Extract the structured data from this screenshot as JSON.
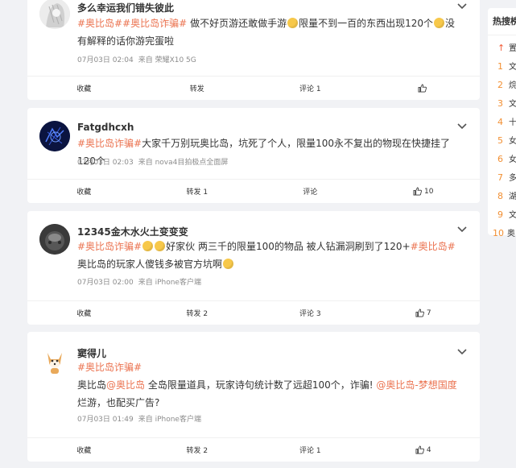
{
  "posts": [
    {
      "username": "多么幸运我们错失彼此",
      "content": [
        {
          "type": "topic",
          "text": "#奥比岛#"
        },
        {
          "type": "topic",
          "text": "#奥比岛诈骗#"
        },
        {
          "type": "text",
          "text": "做不好页游还敢做手游"
        },
        {
          "type": "emoji",
          "name": "thinking-emoji"
        },
        {
          "type": "text",
          "text": "限量不到一百的东西出现120个"
        },
        {
          "type": "emoji",
          "name": "thinking-emoji"
        },
        {
          "type": "text",
          "text": "没有解释的话你游完蛋啦"
        }
      ],
      "time": "07月03日 02:04",
      "source": "来自 荣耀X10 5G",
      "actions": {
        "collect": "收藏",
        "repost": "转发",
        "comment": "评论 1",
        "like": ""
      }
    },
    {
      "username": "Fatgdhcxh",
      "content": [
        {
          "type": "topic",
          "text": "#奥比岛诈骗#"
        },
        {
          "type": "text",
          "text": "大家千万别玩奥比岛，坑死了个人，限量100永不复出的物现在快捷挂了120个"
        }
      ],
      "time": "07月03日 02:03",
      "source": "来自 nova4目拍极点全面屏",
      "actions": {
        "collect": "收藏",
        "repost": "转发 1",
        "comment": "评论",
        "like": "10"
      }
    },
    {
      "username": "12345金木水火土变变变",
      "content": [
        {
          "type": "topic",
          "text": "#奥比岛诈骗#"
        },
        {
          "type": "emoji",
          "name": "laughing-emoji"
        },
        {
          "type": "emoji",
          "name": "laughing-emoji"
        },
        {
          "type": "text",
          "text": "好家伙 两三千的限量100的物品 被人钻漏洞刷到了120+"
        },
        {
          "type": "topic",
          "text": "#奥比岛#"
        },
        {
          "type": "text",
          "text": " 奥比岛的玩家人傻钱多被官方坑啊"
        },
        {
          "type": "emoji",
          "name": "laughing-emoji"
        }
      ],
      "time": "07月03日 02:00",
      "source": "来自 iPhone客户端",
      "actions": {
        "collect": "收藏",
        "repost": "转发 2",
        "comment": "评论 3",
        "like": "7"
      }
    },
    {
      "username": "窦得儿",
      "content_line1": [
        {
          "type": "topic",
          "text": "#奥比岛诈骗#"
        }
      ],
      "content": [
        {
          "type": "text",
          "text": "奥比岛"
        },
        {
          "type": "mention",
          "text": "@奥比岛"
        },
        {
          "type": "text",
          "text": " 全岛限量道具，玩家诗句统计数了远超100个，诈骗! "
        },
        {
          "type": "mention",
          "text": "@奥比岛-梦想国度"
        },
        {
          "type": "text",
          "text": " 烂游，也配买广告?"
        }
      ],
      "time": "07月03日 01:49",
      "source": "来自 iPhone客户端",
      "actions": {
        "collect": "收藏",
        "repost": "转发 2",
        "comment": "评论 1",
        "like": "4"
      }
    }
  ],
  "sidebar": {
    "title": "热搜榜",
    "rows": [
      {
        "num": "",
        "text": "置"
      },
      {
        "num": "1",
        "text": "文"
      },
      {
        "num": "2",
        "text": "烷"
      },
      {
        "num": "3",
        "text": "文"
      },
      {
        "num": "4",
        "text": "十"
      },
      {
        "num": "5",
        "text": "女"
      },
      {
        "num": "6",
        "text": "女"
      },
      {
        "num": "7",
        "text": "多"
      },
      {
        "num": "8",
        "text": "湖"
      },
      {
        "num": "9",
        "text": "文"
      },
      {
        "num": "10",
        "text": "奥"
      }
    ]
  },
  "colors": {
    "accent": "#eb7350",
    "rank": "#f28f32",
    "background": "#f1f2f5"
  }
}
